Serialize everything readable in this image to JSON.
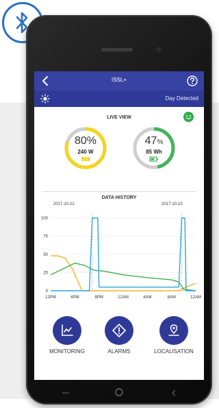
{
  "app": {
    "title": "ISSL+",
    "status_text": "Day Detected"
  },
  "live_view": {
    "title": "LIVE VIEW",
    "solar": {
      "percent": 80,
      "percent_text": "80%",
      "power_text": "240 W",
      "color": "#f2d61f"
    },
    "battery": {
      "percent": 47,
      "percent_number": "47",
      "percent_unit": "%",
      "energy_text": "85 Wh",
      "color": "#44b35a"
    }
  },
  "history": {
    "title": "DATA HISTORY",
    "date_left": "2017-10-22",
    "date_right": "2017-10-23"
  },
  "chart_data": {
    "type": "line",
    "title": "DATA HISTORY",
    "x": [
      "12PM",
      "4PM",
      "8PM",
      "12AM",
      "4AM",
      "8AM",
      "12AM"
    ],
    "y_ticks": [
      "100",
      "75",
      "50",
      "25",
      "0"
    ],
    "ylim": [
      0,
      100
    ],
    "series": [
      {
        "color": "#f0b429",
        "points": [
          [
            0,
            48
          ],
          [
            0.3,
            48
          ],
          [
            0.6,
            45
          ],
          [
            0.9,
            30
          ],
          [
            1.3,
            0
          ],
          [
            1.7,
            0
          ],
          [
            2.0,
            0
          ],
          [
            3.0,
            0
          ],
          [
            5.3,
            0
          ],
          [
            5.6,
            5
          ],
          [
            6.0,
            10
          ]
        ]
      },
      {
        "color": "#3fae49",
        "points": [
          [
            0,
            22
          ],
          [
            0.5,
            30
          ],
          [
            1.0,
            38
          ],
          [
            1.4,
            35
          ],
          [
            1.8,
            28
          ],
          [
            2.2,
            27
          ],
          [
            3.0,
            22
          ],
          [
            4.0,
            18
          ],
          [
            5.0,
            15
          ],
          [
            5.3,
            12
          ],
          [
            5.5,
            2
          ],
          [
            6.0,
            0
          ]
        ]
      },
      {
        "color": "#2aa8d8",
        "points": [
          [
            0,
            0
          ],
          [
            1.6,
            0
          ],
          [
            1.72,
            100
          ],
          [
            1.95,
            100
          ],
          [
            2.0,
            5
          ],
          [
            3.0,
            5
          ],
          [
            5.3,
            5
          ],
          [
            5.42,
            100
          ],
          [
            5.55,
            100
          ],
          [
            5.6,
            0
          ],
          [
            6.0,
            0
          ]
        ]
      }
    ]
  },
  "nav": [
    {
      "label": "MONITORING"
    },
    {
      "label": "ALARMS"
    },
    {
      "label": "LOCALISATION"
    }
  ],
  "colors": {
    "appbar": "#3742a3",
    "statusbar": "#2f3a98",
    "bluetooth": "#2a6fc2"
  }
}
